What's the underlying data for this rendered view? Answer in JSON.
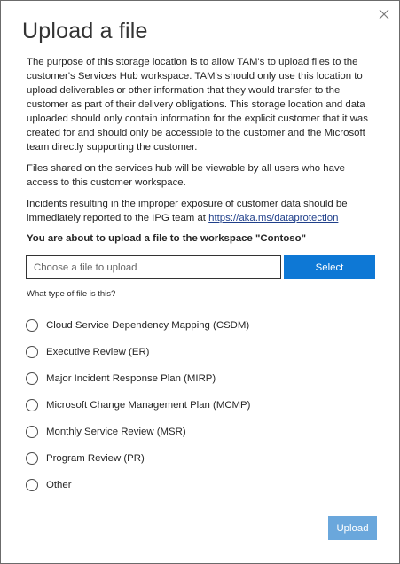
{
  "dialog": {
    "title": "Upload a file",
    "close_icon": "close-icon"
  },
  "description": {
    "paragraph1": "The purpose of this storage location is to allow TAM's to upload files to the customer's Services Hub workspace. TAM's should only use this location to upload deliverables or other information that they would transfer to the customer as part of their delivery obligations. This storage location and data uploaded should only contain information for the explicit customer that it was created for and should only be accessible to the customer and the Microsoft team directly supporting the customer.",
    "paragraph2": "Files shared on the services hub will be viewable by all users who have access to this customer workspace.",
    "paragraph3_prefix": "Incidents resulting in the improper exposure of customer data should be immediately reported to the IPG team at ",
    "paragraph3_link": "https://aka.ms/dataprotection"
  },
  "workspace_notice": "You are about to upload a file to the workspace \"Contoso\"",
  "file_picker": {
    "placeholder": "Choose a file to upload",
    "value": "",
    "select_label": "Select"
  },
  "file_type": {
    "label": "What type of file is this?",
    "options": [
      "Cloud Service Dependency Mapping (CSDM)",
      "Executive Review (ER)",
      "Major Incident Response Plan (MIRP)",
      "Microsoft Change Management Plan (MCMP)",
      "Monthly Service Review (MSR)",
      "Program Review (PR)",
      "Other"
    ]
  },
  "footer": {
    "upload_label": "Upload"
  },
  "colors": {
    "primary": "#0e78d5",
    "primary_disabled": "#6aa7dc",
    "link": "#1f3f8a"
  }
}
